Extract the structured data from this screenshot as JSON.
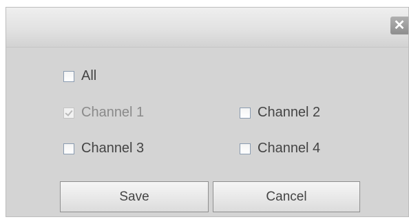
{
  "dialog": {
    "close_glyph": "✕",
    "checkboxes": {
      "all": {
        "label": "All",
        "checked": false
      },
      "channel1": {
        "label": "Channel 1",
        "checked": true,
        "disabled": true
      },
      "channel2": {
        "label": "Channel 2",
        "checked": false
      },
      "channel3": {
        "label": "Channel 3",
        "checked": false
      },
      "channel4": {
        "label": "Channel 4",
        "checked": false
      }
    },
    "buttons": {
      "save_label": "Save",
      "cancel_label": "Cancel"
    }
  },
  "colors": {
    "dialog_bg": "#d4d4d4",
    "close_bg": "#9f9f9f",
    "text": "#444444"
  }
}
